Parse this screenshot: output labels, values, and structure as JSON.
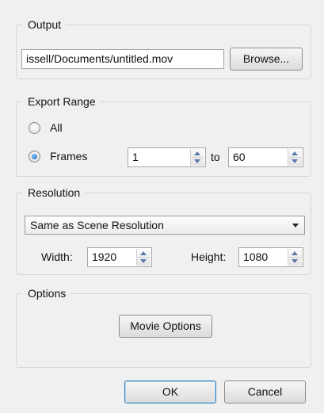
{
  "output": {
    "group_title": "Output",
    "path_value": "issell/Documents/untitled.mov",
    "browse_label": "Browse..."
  },
  "export_range": {
    "group_title": "Export Range",
    "all_label": "All",
    "frames_label": "Frames",
    "frame_start": "1",
    "to_label": "to",
    "frame_end": "60",
    "selected": "Frames"
  },
  "resolution": {
    "group_title": "Resolution",
    "preset_value": "Same as Scene Resolution",
    "width_label": "Width:",
    "width_value": "1920",
    "height_label": "Height:",
    "height_value": "1080"
  },
  "options": {
    "group_title": "Options",
    "movie_options_label": "Movie Options"
  },
  "footer": {
    "ok_label": "OK",
    "cancel_label": "Cancel"
  }
}
